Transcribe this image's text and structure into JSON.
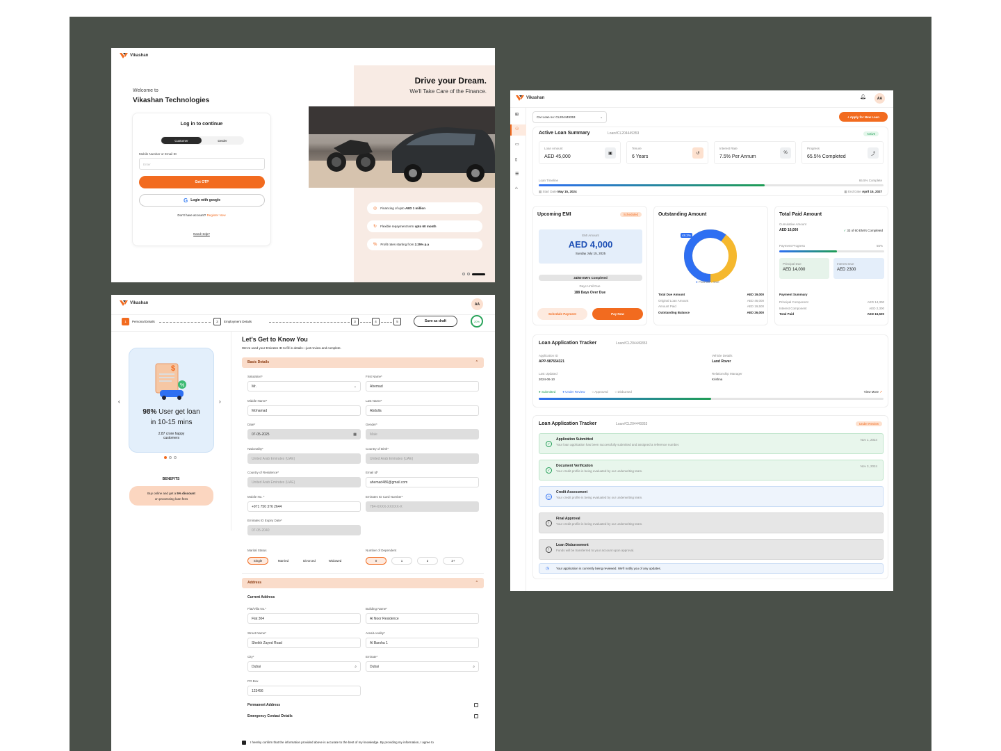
{
  "login": {
    "brand": "Vikashan",
    "welcome": "Welcome to",
    "company": "Vikashan Technologies",
    "card_title": "Log in to continue",
    "tab_customer": "Customer",
    "tab_dealer": "Dealer",
    "input_label": "Mobile Number or Email ID",
    "input_placeholder": "Enter",
    "otp_button": "Get OTP",
    "google_button": "Login with google",
    "no_account": "Don't have account?",
    "register": "Register Now",
    "help": "Need Help?",
    "hero_title": "Drive your Dream.",
    "hero_sub": "We'll Take Care of the Finance.",
    "features": [
      {
        "text": "Financing of upto ",
        "bold": "AED 1 million"
      },
      {
        "text": "Flexible repayment term ",
        "bold": "upto 60 month"
      },
      {
        "text": "Profit rates starting from ",
        "bold": "2.25% p.a"
      }
    ]
  },
  "form": {
    "brand": "Vikashan",
    "avatar": "AA",
    "steps": [
      {
        "num": "1",
        "label": "Personal Details"
      },
      {
        "num": "2",
        "label": "Employment Details"
      },
      {
        "num": "3",
        "label": ""
      },
      {
        "num": "4",
        "label": ""
      },
      {
        "num": "5",
        "label": ""
      }
    ],
    "save_draft": "Save as draft",
    "progress": "20%",
    "promo_stat": "98%",
    "promo_text": " User get loan",
    "promo_text2": "in 10-15 mins",
    "promo_sub": "2.87 crore happy customers",
    "benefits_title": "BENEFITS",
    "benefit_text": "Buy online and get a ",
    "benefit_bold": "5% discount",
    "benefit_text2": "on processing loan fees",
    "title": "Let's Get to Know You",
    "subtitle": "We've used your Emirates ID to fill in details—just review and complete.",
    "section_basic": "Basic Details",
    "fields": {
      "salutation_l": "Salutation*",
      "salutation_v": "Mr.",
      "first_l": "First Name*",
      "first_v": "Ahemad",
      "middle_l": "Middle Name*",
      "middle_v": "Mohamad",
      "last_l": "Last Name*",
      "last_v": "Abdulla",
      "date_l": "Date*",
      "date_v": "07-05-2025",
      "gender_l": "Gender*",
      "gender_v": "Male",
      "nat_l": "Nationality*",
      "nat_v": "United Arab Emirates (UAE)",
      "cob_l": "Country of Birth*",
      "cob_v": "United Arab Emirates (UAE)",
      "cor_l": "Country of Residence*",
      "cor_v": "United Arab Emirates (UAE)",
      "email_l": "Email Id*",
      "email_v": "ahemad486@gmail.com",
      "mobile_l": "Mobile No. *",
      "mobile_v": "+971 750 376 2644",
      "eid_l": "Emirates ID Card Number*",
      "eid_v": "784-XXXX-XXXXX-X",
      "eidx_l": "Emirates ID Expiry Date*",
      "eidx_v": "07-05-2040",
      "marital_l": "Marital Status",
      "dep_l": "Number of Dependent"
    },
    "marital": [
      "Single",
      "Married",
      "Divorced",
      "Widowed"
    ],
    "dependents": [
      "0",
      "1",
      "2",
      "3+"
    ],
    "section_address": "Address",
    "current_address": "Current Address",
    "addr": {
      "flat_l": "Flat/Villa No.*",
      "flat_v": "Flat 304",
      "bld_l": "Building Name*",
      "bld_v": "Al Noor Residence",
      "street_l": "Street Name*",
      "street_v": "Sheikh Zayed Road",
      "area_l": "Area/Locality*",
      "area_v": "Al Barsha 1",
      "city_l": "City*",
      "city_v": "Dubai",
      "emirate_l": "Emirate*",
      "emirate_v": "Dubai",
      "po_l": "PO Box",
      "po_v": "123456"
    },
    "permanent": "Permanent Address",
    "emergency": "Emergency Contact Details",
    "confirm": "I hereby confirm that the information provided above is accurate to the best of my knowledge. By providing my information, I agree to"
  },
  "dash": {
    "brand": "Vikashan",
    "avatar": "AA",
    "loan_select": "Car Loan no: CL204449353",
    "apply": "+ Apply for New Loan",
    "summary_title": "Active Loan Summary",
    "loan_no": "Loan#CL204449353",
    "status_active": "Active",
    "stats": [
      {
        "label": "Loan Amount",
        "value": "AED 45,000",
        "icon": "money-icon"
      },
      {
        "label": "Tenure",
        "value": "6 Years",
        "icon": "history-icon"
      },
      {
        "label": "Interest Rate",
        "value": "7.5% Per Annum",
        "icon": "percent-icon"
      },
      {
        "label": "Progress",
        "value": "65.5% Completed",
        "icon": "chart-icon"
      }
    ],
    "timeline_label": "Loan Timeline",
    "timeline_pct_text": "65.5% Complete",
    "timeline_progress": 0.655,
    "start_label": "Start Date",
    "start": "May 15, 2024",
    "end_label": "End Date",
    "end": "April 15, 2027",
    "emi_title": "Upcoming EMI",
    "emi_badge": "Scheduled",
    "emi_label": "EMI Amount",
    "emi_amount": "AED 4,000",
    "emi_date": "Sunday  July 15, 2025",
    "emi_done": "34/60 EMI's Completed",
    "days_label": "Days Until Due",
    "days": "188 Days Over Due",
    "schedule_btn": "Schedule Payment",
    "pay_btn": "Pay Now",
    "out_title": "Outstanding Amount",
    "donut_label": "48.3%",
    "donut_paid": 0.6,
    "legend_paid": "Paid Off",
    "legend_due": "Due",
    "out_rows": [
      {
        "k": "Total Due Amount",
        "v": "AED 19,000",
        "bold": true
      },
      {
        "k": "Original Loan Amount",
        "v": "AED 46,000",
        "bold": false
      },
      {
        "k": "Amount Paid",
        "v": "AED 19,500",
        "bold": false
      },
      {
        "k": "Outstanding Balance",
        "v": "AED 26,000",
        "bold": true
      }
    ],
    "paid_title": "Total Paid Amount",
    "cum_label": "Cumulative Amount",
    "cum_value": "AED 16,000",
    "emis_done": "33 of 60 EMI's Completed",
    "pp_label": "Payment Progress",
    "pp_pct": "55%",
    "pp_value": 0.55,
    "principal_label": "Principal Due",
    "principal": "AED 14,000",
    "interest_label": "Interest Due",
    "interest": "AED 2300",
    "ps_title": "Payment Summary",
    "ps_rows": [
      {
        "k": "Principal Component",
        "v": "AED 14,300",
        "bold": false
      },
      {
        "k": "Interest Component",
        "v": "AED 2,300",
        "bold": false
      },
      {
        "k": "Total Paid",
        "v": "AED 16,500",
        "bold": true
      }
    ],
    "tracker_title": "Loan Application Tracker",
    "tracker_loan": "Loan#CL204449353",
    "app_id_label": "Application ID",
    "app_id": "APP-987654321",
    "vehicle_label": "Vehicle Details",
    "vehicle": "Land Rover",
    "updated_label": "Last Updated",
    "updated": "2024-06-10",
    "rm_label": "Relationship Manager",
    "rm": "Krishna",
    "steps": [
      "Submitted",
      "Under Review",
      "Approved",
      "Disbursed"
    ],
    "view_more": "View More",
    "tracker_progress": 0.5,
    "tracker2_badge": "Under Review",
    "items": [
      {
        "title": "Application Submitted",
        "desc": "Your loan application has been successfully submitted and assigned a reference number.",
        "date": "Nov 1, 2024",
        "state": "done"
      },
      {
        "title": "Document Verification",
        "desc": "Your credit profile is being evaluated by our underwriting team.",
        "date": "Nov 3, 2024",
        "state": "done"
      },
      {
        "title": "Credit Assessment",
        "desc": "Your credit profile is being evaluated by our underwriting team.",
        "date": "",
        "state": "current"
      },
      {
        "title": "Final Approval",
        "desc": "Your credit profile is being evaluated by our underwriting team.",
        "date": "",
        "state": "pending"
      },
      {
        "title": "Loan Disbursement",
        "desc": "Funds will be transferred to your account upon approval.",
        "date": "",
        "state": "pending"
      }
    ],
    "notice": "Your application is currently being reviewed. We'll notify you of any updates."
  },
  "colors": {
    "accent": "#f26b1f",
    "blue": "#2e6ff2",
    "green": "#1f9d55",
    "yellow": "#f5b82e",
    "bg": "#4a5049"
  }
}
